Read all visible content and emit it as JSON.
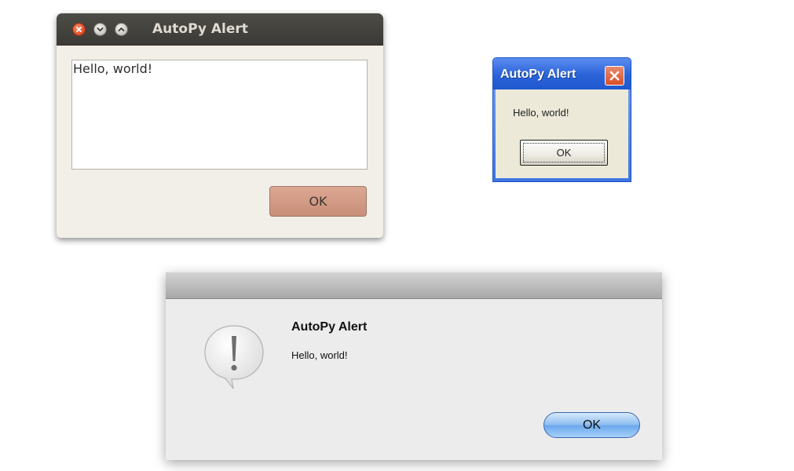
{
  "ubuntu_dialog": {
    "title": "AutoPy Alert",
    "message": "Hello, world!",
    "ok_label": "OK",
    "icons": [
      "close-icon",
      "minimize-icon",
      "maximize-icon"
    ],
    "colors": {
      "titlebar": "#3f3e3a",
      "body": "#f2eee8",
      "button": "#d09a85"
    }
  },
  "windows_dialog": {
    "title": "AutoPy Alert",
    "message": "Hello, world!",
    "ok_label": "OK",
    "icons": [
      "close-icon"
    ],
    "colors": {
      "titlebar": "#2a63d8",
      "body": "#ece9d8",
      "close": "#d8502a"
    }
  },
  "mac_dialog": {
    "title": "AutoPy Alert",
    "message": "Hello, world!",
    "ok_label": "OK",
    "icons": [
      "alert-icon"
    ],
    "colors": {
      "body": "#ececec",
      "button": "#8cbcf0"
    }
  }
}
